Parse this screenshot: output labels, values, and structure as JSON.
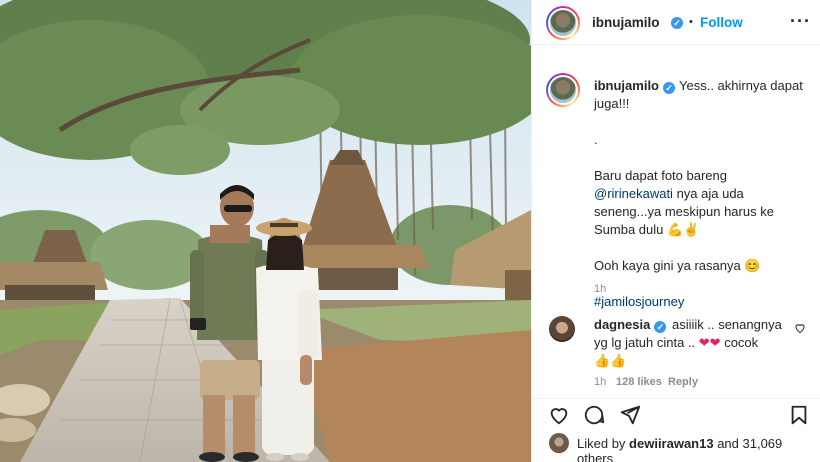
{
  "post": {
    "author": "ibnujamilo",
    "separator": "•",
    "follow_label": "Follow",
    "more_label": "···"
  },
  "caption": {
    "username": "ibnujamilo",
    "line1": "Yess.. akhirnya dapat juga!!!",
    "line2": ".",
    "line3_a": "Baru dapat foto bareng ",
    "line3_mention": "@ririnekawati",
    "line3_b": " nya aja uda seneng...ya meskipun harus ke Sumba dulu ",
    "line3_emoji": "💪✌",
    "line4": "Ooh kaya gini ya rasanya ",
    "line4_emoji": "😊",
    "hashtag": "#jamilosjourney",
    "time": "1h"
  },
  "comment": {
    "username": "dagnesia",
    "text": " asiiiik .. senangnya yg lg jatuh cinta .. ",
    "emoji_hearts": "❤❤",
    "text2": " cocok",
    "emoji_clap": "👍👍",
    "time": "1h",
    "likes": "128 likes",
    "reply_label": "Reply",
    "like_icon": "heart-outline-icon"
  },
  "actions": {
    "like_icon": "heart-outline-icon",
    "comment_icon": "comment-icon",
    "share_icon": "paper-plane-icon",
    "save_icon": "bookmark-icon"
  },
  "likes_summary": {
    "prefix": "Liked by ",
    "user": "dewiirawan13",
    "suffix": " and 31,069 others"
  },
  "colors": {
    "link": "#0095f6",
    "mention": "#00376b",
    "verified": "#3897f0",
    "muted": "#8e8e8e"
  }
}
